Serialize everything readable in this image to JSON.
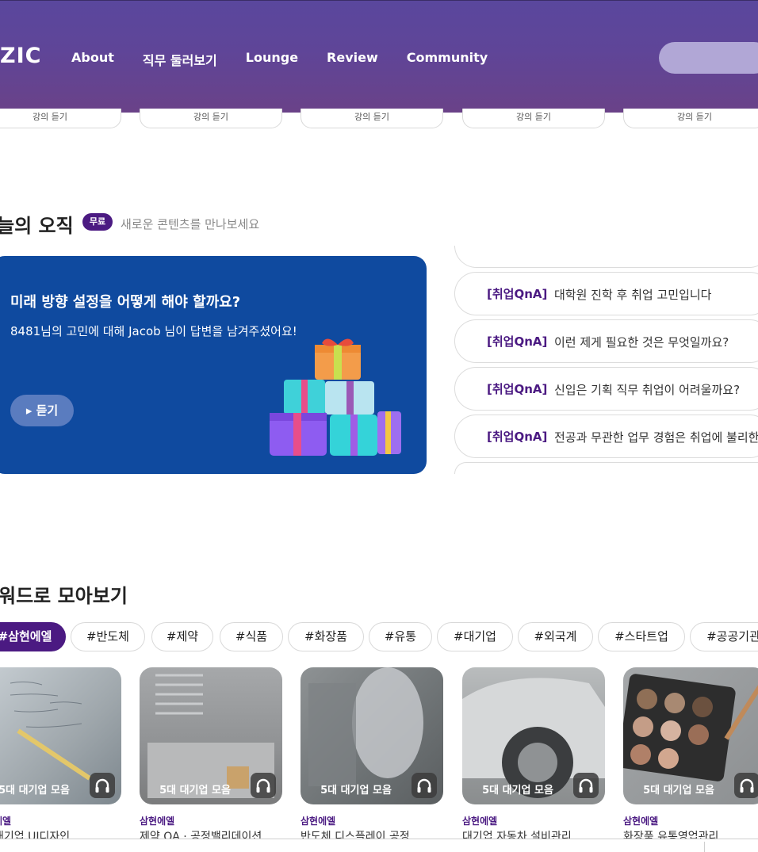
{
  "header": {
    "logo": "ZIC",
    "nav": [
      "About",
      "직무 둘러보기",
      "Lounge",
      "Review",
      "Community"
    ]
  },
  "lectures": {
    "button_label": "강의 듣기"
  },
  "today": {
    "title": "늘의 오직",
    "badge": "무료",
    "subtitle": "새로운 콘텐츠를 만나보세요",
    "card": {
      "title": "미래 방향 설정을 어떻게 해야 할까요?",
      "desc": "8481님의 고민에 대해 Jacob 님이 답변을 남겨주셨어요!",
      "listen": "▸ 듣기"
    },
    "qna": [
      {
        "tag": "[취업QnA]",
        "text": "대학원 진학 후 취업 고민입니다"
      },
      {
        "tag": "[취업QnA]",
        "text": "이런 제게 필요한 것은 무엇일까요?"
      },
      {
        "tag": "[취업QnA]",
        "text": "신입은 기획 직무 취업이 어려울까요?"
      },
      {
        "tag": "[취업QnA]",
        "text": "전공과 무관한 업무 경험은 취업에 불리한"
      }
    ]
  },
  "keywords": {
    "title": "워드로 모아보기",
    "chips": [
      "#삼현에엘",
      "#반도체",
      "#제약",
      "#식품",
      "#화장품",
      "#유통",
      "#대기업",
      "#외국계",
      "#스타트업",
      "#공공기관"
    ]
  },
  "cards": [
    {
      "badge": "5대 대기업 모음",
      "company": "에엘",
      "title": "대기업 UI디자인"
    },
    {
      "badge": "5대 대기업 모음",
      "company": "삼현에엘",
      "title": "제약 QA · 공정밸리데이션"
    },
    {
      "badge": "5대 대기업 모음",
      "company": "삼현에엘",
      "title": "반도체 디스플레이 공정"
    },
    {
      "badge": "5대 대기업 모음",
      "company": "삼현에엘",
      "title": "대기업 자동차 설비관리"
    },
    {
      "badge": "5대 대기업 모음",
      "company": "삼현에엘",
      "title": "화장품 유통영업관리"
    }
  ],
  "colors": {
    "header": "#5f4598",
    "accent_purple": "#4b1a82",
    "blue_card": "#0f4a9f"
  },
  "icons": {
    "headphones": "headphones-icon",
    "gift_boxes": "gift-boxes-illustration"
  }
}
